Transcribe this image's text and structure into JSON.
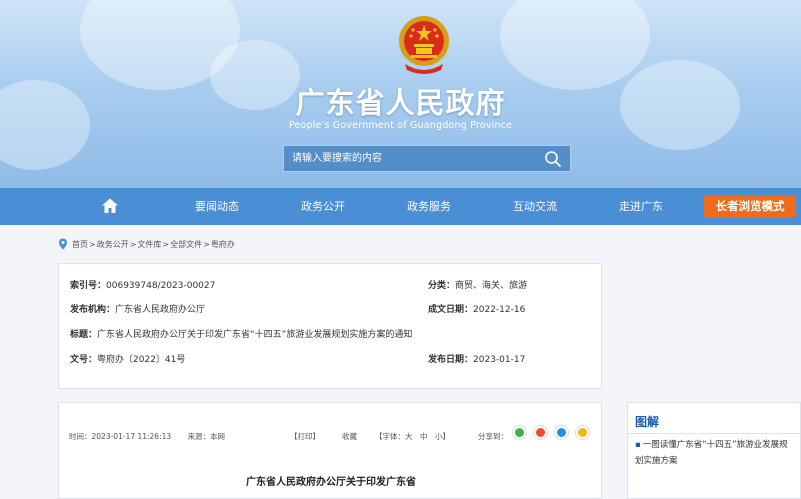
{
  "header": {
    "title": "广东省人民政府",
    "subtitle": "People's Government of Guangdong Province",
    "search_placeholder": "请输入要搜索的内容"
  },
  "nav": {
    "items": [
      "要闻动态",
      "政务公开",
      "政务服务",
      "互动交流",
      "走进广东"
    ],
    "elder_mode": "长者浏览模式"
  },
  "breadcrumb": [
    "首页",
    "政务公开",
    "文件库",
    "全部文件",
    "粤府办"
  ],
  "info": {
    "index_label": "索引号：",
    "index_value": "006939748/2023-00027",
    "category_label": "分类：",
    "category_value": "商贸、海关、旅游",
    "issuer_label": "发布机构：",
    "issuer_value": "广东省人民政府办公厅",
    "date_made_label": "成文日期：",
    "date_made_value": "2022-12-16",
    "title_label": "标题：",
    "title_value": "广东省人民政府办公厅关于印发广东省“十四五”旅游业发展规划实施方案的通知",
    "doc_no_label": "文号：",
    "doc_no_value": "粤府办〔2022〕41号",
    "pub_date_label": "发布日期：",
    "pub_date_value": "2023-01-17"
  },
  "article": {
    "time": "时间：2023-01-17 11:26:13",
    "source": "来源：本网",
    "print": "【打印】",
    "favorite": "收藏",
    "font_size": "【字体：大　中　小】",
    "share_label": "分享到：",
    "title": "广东省人民政府办公厅关于印发广东省"
  },
  "side": {
    "title": "图解",
    "link": "一图读懂广东省“十四五”旅游业发展规划实施方案"
  },
  "colors": {
    "nav_bg": "#4a8fd6",
    "elder_btn": "#f06a1c",
    "side_title": "#1a5ea8"
  }
}
